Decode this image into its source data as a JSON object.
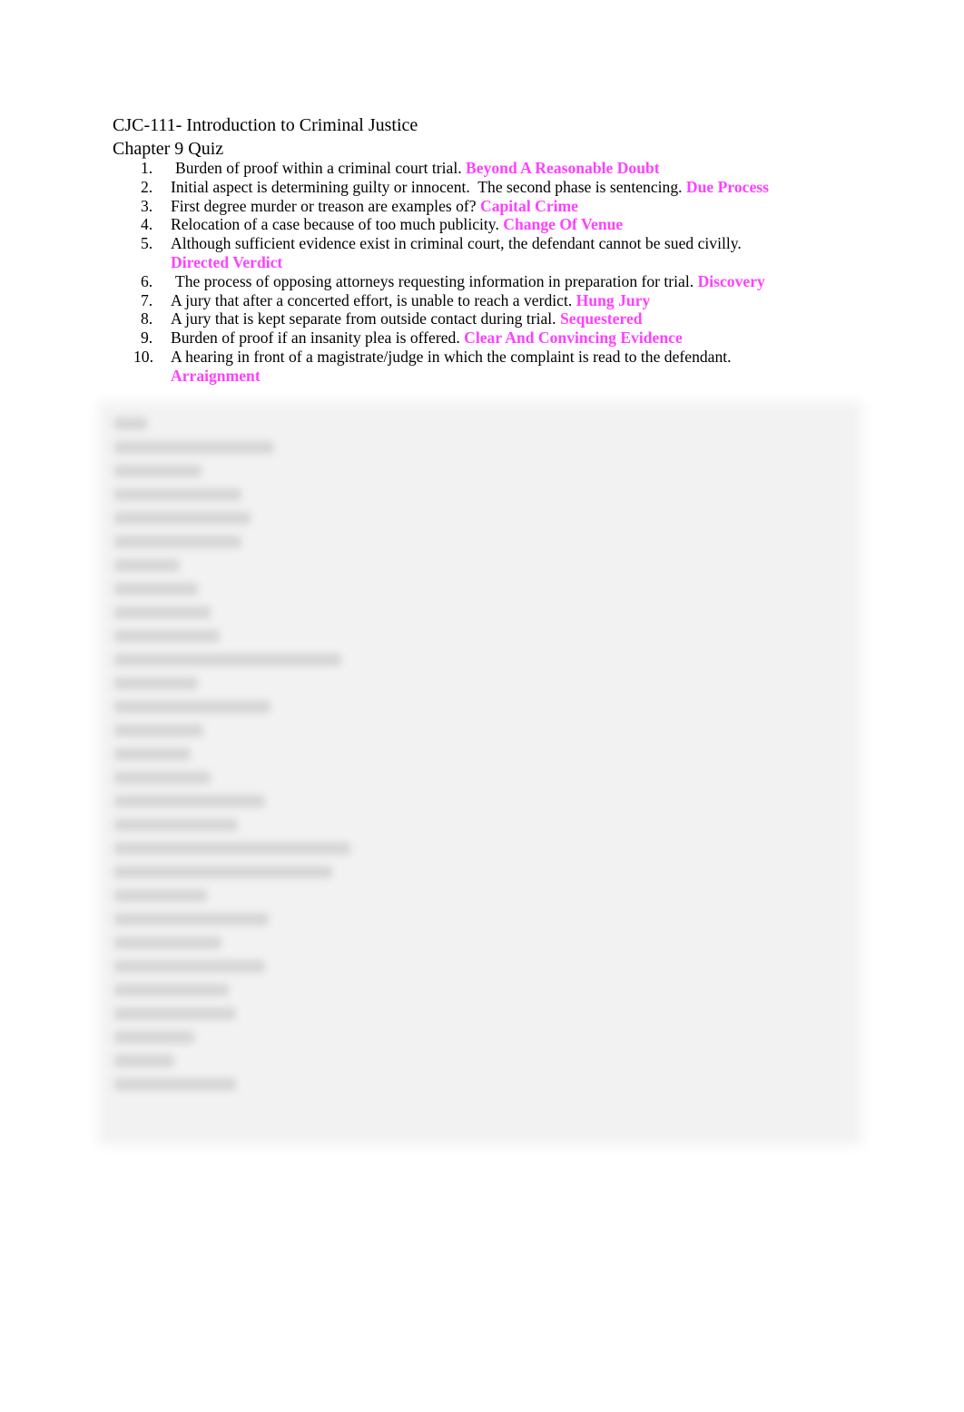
{
  "document": {
    "course_title": "CJC-111- Introduction to Criminal Justice",
    "quiz_title": "Chapter 9 Quiz",
    "answer_color": "#FF40FF",
    "questions": [
      {
        "number": "1.",
        "text": "Burden of proof within a criminal court trial.",
        "answer": "Beyond A Reasonable Doubt"
      },
      {
        "number": "2.",
        "text": "Initial aspect is determining guilty or innocent.  The second phase is sentencing.",
        "answer": "Due Process"
      },
      {
        "number": "3.",
        "text": "First degree murder or treason are examples of?",
        "answer": "Capital Crime"
      },
      {
        "number": "4.",
        "text": "Relocation of a case because of too much publicity.",
        "answer": "Change Of Venue"
      },
      {
        "number": "5.",
        "text": "Although sufficient evidence exist in criminal court, the defendant cannot be sued civilly.",
        "answer": "Directed Verdict"
      },
      {
        "number": "6.",
        "text": "The process of opposing attorneys requesting information in preparation for trial.",
        "answer": "Discovery"
      },
      {
        "number": "7.",
        "text": "A jury that after a concerted effort, is unable to reach a verdict.",
        "answer": "Hung Jury"
      },
      {
        "number": "8.",
        "text": "A jury that is kept separate from outside contact during trial.",
        "answer": "Sequestered"
      },
      {
        "number": "9.",
        "text": "Burden of proof if an insanity plea is offered.",
        "answer": "Clear And Convincing Evidence"
      },
      {
        "number": "10.",
        "text": "A hearing in front of a magistrate/judge in which the complaint is read to the defendant.",
        "answer": "Arraignment"
      }
    ],
    "word_bank": {
      "state": "blurred",
      "line_count": 30
    }
  }
}
